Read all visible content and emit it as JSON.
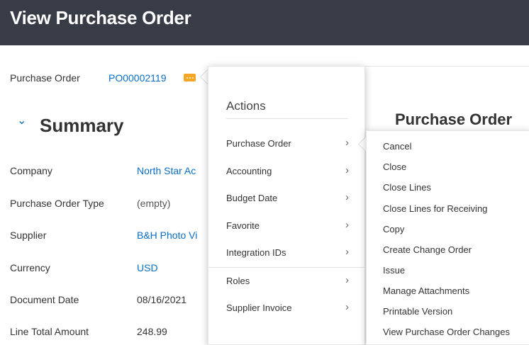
{
  "header": {
    "title": "View Purchase Order"
  },
  "purchase_order": {
    "label": "Purchase Order",
    "value": "PO00002119",
    "related_icon": "related-actions-icon"
  },
  "summary": {
    "chevron": "⌄",
    "title": "Summary",
    "fields": [
      {
        "label": "Company",
        "value": "North Star Ac",
        "link": true
      },
      {
        "label": "Purchase Order Type",
        "value": "(empty)",
        "link": false
      },
      {
        "label": "Supplier",
        "value": "B&H Photo Vi",
        "link": true
      },
      {
        "label": "Currency",
        "value": "USD",
        "link": true
      },
      {
        "label": "Document Date",
        "value": "08/16/2021",
        "link": false
      },
      {
        "label": "Line Total Amount",
        "value": "248.99",
        "link": false
      }
    ]
  },
  "actions_menu": {
    "heading": "Actions",
    "chevron": "›",
    "items": [
      "Purchase Order",
      "Accounting",
      "Budget Date",
      "Favorite",
      "Integration IDs",
      "Roles",
      "Supplier Invoice"
    ]
  },
  "right_panel": {
    "title": "Purchase Order"
  },
  "submenu": {
    "items": [
      "Cancel",
      "Close",
      "Close Lines",
      "Close Lines for Receiving",
      "Copy",
      "Create Change Order",
      "Issue",
      "Manage Attachments",
      "Printable Version",
      "View Purchase Order Changes"
    ]
  },
  "colors": {
    "header_bg": "#373c47",
    "link": "#0a6ec4",
    "related_icon": "#f5a623"
  }
}
